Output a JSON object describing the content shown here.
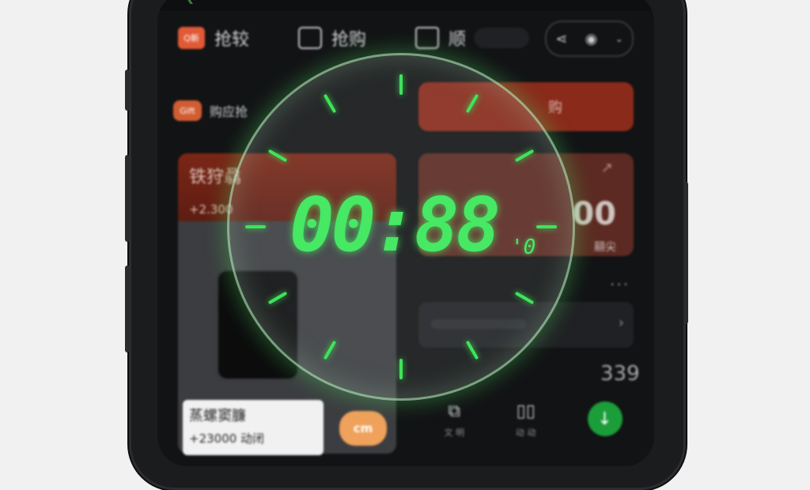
{
  "colors": {
    "accent_green": "#47e864",
    "brand_orange": "#e05a36"
  },
  "header": {
    "tabs": [
      {
        "logo": "Q新",
        "label": "抢较"
      },
      {
        "icon": "tv-icon",
        "label": "抢购"
      },
      {
        "icon": "lock-icon",
        "label": "顺"
      }
    ],
    "actions": {
      "share_icon": "share-icon",
      "view_icon": "eye-icon",
      "menu_icon": "chevron-down-icon"
    }
  },
  "banner": {
    "logo": "Gift",
    "left_text": "购应抢",
    "right_text": "购"
  },
  "card_left": {
    "title": "铁狩骉",
    "subtitle": "+2.300",
    "footer_title": "蒸螺窦臁",
    "footer_sub": "+23000 动闭",
    "cart_badge": "cm"
  },
  "card_right": {
    "big_value": "00",
    "sub_text": "翮尖",
    "more": "..."
  },
  "price_text": "339",
  "bottom_bar": [
    {
      "icon": "gift-icon",
      "label": "文 明"
    },
    {
      "icon": "timer-icon",
      "label": "动 动"
    },
    {
      "icon": "download-icon",
      "label": ""
    }
  ],
  "timer": {
    "display": "00:88",
    "unit": "'0"
  }
}
